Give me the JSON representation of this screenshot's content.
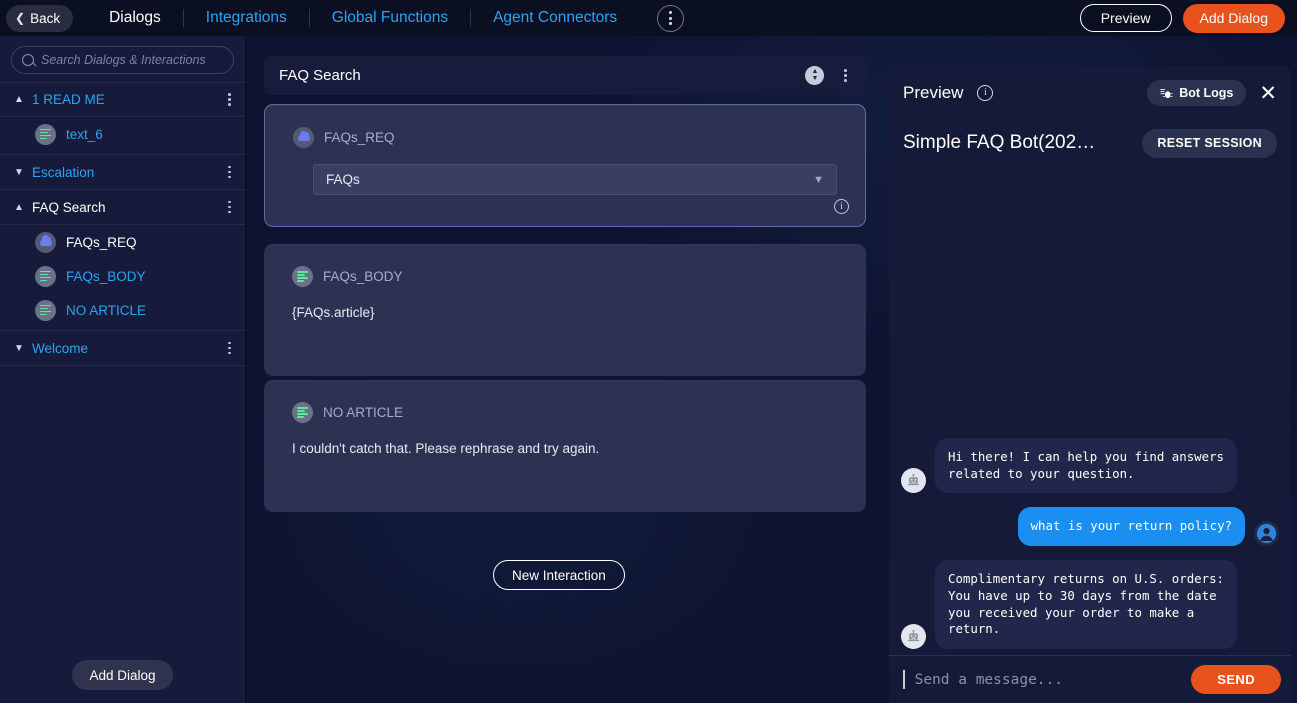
{
  "topbar": {
    "back_label": "Back",
    "tabs": [
      {
        "label": "Dialogs",
        "active": true
      },
      {
        "label": "Integrations",
        "active": false
      },
      {
        "label": "Global Functions",
        "active": false
      },
      {
        "label": "Agent Connectors",
        "active": false
      }
    ],
    "overflow_icon": "kebab-vertical-icon",
    "preview_label": "Preview",
    "add_dialog_label": "Add Dialog",
    "accent_orange": "#e8521c",
    "accent_blue": "#2aa4f4"
  },
  "sidebar": {
    "search": {
      "placeholder": "Search Dialogs & Interactions",
      "value": "",
      "icon": "search-icon"
    },
    "groups": [
      {
        "label": "1 READ ME",
        "expanded": true,
        "caret": "chevron-up-icon",
        "active": false,
        "children": [
          {
            "label": "text_6",
            "icon": "text-lines-icon",
            "active": false
          }
        ]
      },
      {
        "label": "Escalation",
        "expanded": false,
        "caret": "chevron-down-icon",
        "active": false,
        "children": []
      },
      {
        "label": "FAQ Search",
        "expanded": true,
        "caret": "chevron-up-icon",
        "active": true,
        "children": [
          {
            "label": "FAQs_REQ",
            "icon": "cloud-icon",
            "active": true
          },
          {
            "label": "FAQs_BODY",
            "icon": "text-lines-icon",
            "active": false
          },
          {
            "label": "NO ARTICLE",
            "icon": "text-lines-icon",
            "active": false
          }
        ]
      },
      {
        "label": "Welcome",
        "expanded": false,
        "caret": "chevron-down-icon",
        "active": false,
        "children": []
      }
    ],
    "add_dialog_label": "Add Dialog"
  },
  "canvas": {
    "header": {
      "title": "FAQ Search",
      "collapse_icon": "expand-collapse-icon",
      "menu_icon": "kebab-vertical-icon"
    },
    "nodes": [
      {
        "name": "FAQs_REQ",
        "icon": "cloud-icon",
        "selected": true,
        "field_type": "select",
        "field_value": "FAQs",
        "chevron": "chevron-down-icon",
        "info_icon": "info-icon"
      },
      {
        "name": "FAQs_BODY",
        "icon": "text-lines-icon",
        "selected": false,
        "field_type": "text",
        "body": "{FAQs.article}"
      },
      {
        "name": "NO ARTICLE",
        "icon": "text-lines-icon",
        "selected": false,
        "field_type": "text",
        "body": "I couldn't catch that. Please rephrase and try again."
      }
    ],
    "new_interaction_label": "New Interaction"
  },
  "preview": {
    "title": "Preview",
    "info_icon": "info-icon",
    "bot_logs_label": "Bot Logs",
    "bot_logs_icon": "bug-icon",
    "close_icon": "close-icon",
    "bot_title": "Simple FAQ Bot(202…",
    "reset_label": "RESET SESSION",
    "messages": [
      {
        "from": "bot",
        "avatar": "robot-avatar-icon",
        "text": "Hi there! I can help you find answers related to your question."
      },
      {
        "from": "user",
        "avatar": "user-avatar-icon",
        "text": "what is your return policy?"
      },
      {
        "from": "bot",
        "avatar": "robot-avatar-icon",
        "text": "Complimentary returns on U.S. orders: You have up to 30 days from the date you received your order to make a return."
      }
    ],
    "input": {
      "placeholder": "Send a message...",
      "value": ""
    },
    "send_label": "SEND"
  }
}
